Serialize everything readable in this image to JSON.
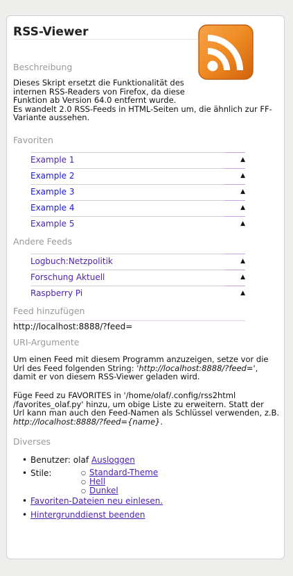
{
  "title": "RSS-Viewer",
  "logo_icon": "rss-feed-icon",
  "colors": {
    "accent": "#ee7d1c",
    "link": "#4b1fb4",
    "section": "#999999"
  },
  "beschreibung": {
    "heading": "Beschreibung",
    "text": "Dieses Skript ersetzt die Funktionalität des\ninternen RSS-Readers von Firefox, da diese\nFunktion ab Version 64.0 entfernt wurde.\nEs wandelt 2.0 RSS-Feeds in HTML-Seiten um, die ähnlich zur FF-\nVariante aussehen."
  },
  "favoriten": {
    "heading": "Favoriten",
    "items": [
      {
        "label": "Example 1",
        "icon": "up-arrow-icon"
      },
      {
        "label": "Example 2",
        "icon": "up-arrow-icon"
      },
      {
        "label": "Example 3",
        "icon": "up-arrow-icon"
      },
      {
        "label": "Example 4",
        "icon": "up-arrow-icon"
      },
      {
        "label": "Example 5",
        "icon": "up-arrow-icon"
      }
    ]
  },
  "andere": {
    "heading": "Andere Feeds",
    "items": [
      {
        "label": "Logbuch:Netzpolitik",
        "icon": "up-arrow-icon"
      },
      {
        "label": "Forschung Aktuell",
        "icon": "up-arrow-icon"
      },
      {
        "label": "Raspberry Pi",
        "icon": "up-arrow-icon"
      }
    ]
  },
  "add_feed": {
    "heading": "Feed hinzufügen",
    "value": "http://localhost:8888/?feed="
  },
  "uri": {
    "heading": "URI-Argumente",
    "p1_a": "Um einen Feed mit diesem Programm anzuzeigen, setze vor die\nUrl des Feed folgenden String: '",
    "p1_code": "http://localhost:8888/?feed=",
    "p1_b": "',\ndamit er von diesem RSS-Viewer geladen wird.",
    "p2_a": "Füge Feed zu FAVORITES in '/home/olaf/.config/rss2html\n/favorites_olaf.py' hinzu, um obige Liste zu erweitern. Statt der\nUrl kann man auch den Feed-Namen als Schlüssel verwenden, z.B.\n",
    "p2_code": "http://localhost:8888/?feed={name}",
    "p2_b": "."
  },
  "diverses": {
    "heading": "Diverses",
    "user_label": "Benutzer: olaf",
    "logout": "Ausloggen",
    "styles_label": "Stile:",
    "styles": [
      "Standard-Theme",
      "Hell",
      "Dunkel"
    ],
    "reload": "Favoriten-Dateien neu einlesen.",
    "stop": "Hintergrunddienst beenden"
  }
}
